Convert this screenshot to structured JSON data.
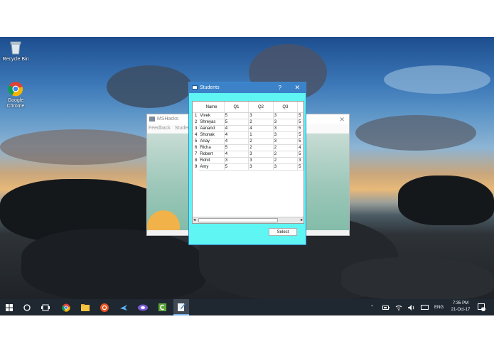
{
  "desktop": {
    "icons": [
      {
        "label": "Recycle Bin",
        "icon": "recycle-bin-icon"
      },
      {
        "label": "Google Chrome",
        "icon": "chrome-icon"
      }
    ]
  },
  "background_window": {
    "title": "MSHacks",
    "close_glyph": "✕",
    "menu": [
      "Feedback",
      "Student"
    ]
  },
  "dialog": {
    "title": "Students",
    "help_glyph": "?",
    "close_glyph": "✕",
    "table": {
      "columns": [
        "Name",
        "Q1",
        "Q2",
        "Q3",
        ""
      ],
      "rows": [
        {
          "n": "1",
          "name": "Vivek",
          "q1": "5",
          "q2": "3",
          "q3": "3",
          "q4": "5"
        },
        {
          "n": "2",
          "name": "Shreyas",
          "q1": "5",
          "q2": "2",
          "q3": "3",
          "q4": "5"
        },
        {
          "n": "3",
          "name": "Aanand",
          "q1": "4",
          "q2": "4",
          "q3": "3",
          "q4": "5"
        },
        {
          "n": "4",
          "name": "Shonak",
          "q1": "4",
          "q2": "1",
          "q3": "3",
          "q4": "5"
        },
        {
          "n": "5",
          "name": "Anay",
          "q1": "4",
          "q2": "2",
          "q3": "3",
          "q4": "5"
        },
        {
          "n": "6",
          "name": "Richa",
          "q1": "5",
          "q2": "2",
          "q3": "2",
          "q4": "4"
        },
        {
          "n": "7",
          "name": "Robert",
          "q1": "4",
          "q2": "3",
          "q3": "2",
          "q4": "5"
        },
        {
          "n": "8",
          "name": "Rohit",
          "q1": "3",
          "q2": "3",
          "q3": "2",
          "q4": "3"
        },
        {
          "n": "9",
          "name": "Amy",
          "q1": "5",
          "q2": "3",
          "q3": "3",
          "q4": "5"
        }
      ]
    },
    "scroll_left": "◂",
    "scroll_right": "▸",
    "select_label": "Select",
    "colors": {
      "title_bar": "#3b82c9",
      "body": "#5ef5f2"
    }
  },
  "taskbar": {
    "items": [
      "windows-start-icon",
      "cortana-search-icon",
      "task-view-icon",
      "chrome-icon",
      "file-explorer-icon",
      "ubuntu-icon",
      "airplane-app-icon",
      "media-app-icon",
      "camtasia-icon",
      "notepad-app-icon"
    ],
    "tray": {
      "language": "ENG",
      "time": "7:35 PM",
      "date": "21-Oct-17",
      "notifications": "6"
    }
  }
}
